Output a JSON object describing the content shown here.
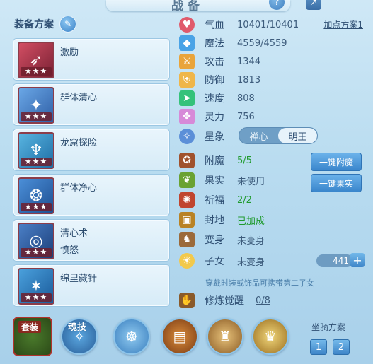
{
  "window": {
    "title": "战备"
  },
  "plan": {
    "title": "装备方案",
    "add_plan_label": "加点方案1"
  },
  "skills": [
    {
      "name": "激励",
      "sub": "",
      "stars": "★★★",
      "icon": "arrow-skill-icon",
      "color": "#b23a4d"
    },
    {
      "name": "群体清心",
      "sub": "",
      "stars": "★★★",
      "icon": "heal-skill-icon",
      "color": "#3f77c4"
    },
    {
      "name": "龙窟探险",
      "sub": "",
      "stars": "★★★",
      "icon": "dragon-skill-icon",
      "color": "#2e8fbd"
    },
    {
      "name": "群体净心",
      "sub": "",
      "stars": "★★★",
      "icon": "purify-skill-icon",
      "color": "#2b6fb0"
    },
    {
      "name": "清心术",
      "sub": "愤怒",
      "stars": "★★★",
      "icon": "gold-ring-skill-icon",
      "color": "#2d64a8"
    },
    {
      "name": "绵里藏针",
      "sub": "",
      "stars": "★★★",
      "icon": "needle-skill-icon",
      "color": "#2a7cc0"
    }
  ],
  "stats": {
    "hp": {
      "label": "气血",
      "value": "10401/10401"
    },
    "mp": {
      "label": "魔法",
      "value": "4559/4559"
    },
    "atk": {
      "label": "攻击",
      "value": "1344"
    },
    "def": {
      "label": "防御",
      "value": "1813"
    },
    "spd": {
      "label": "速度",
      "value": "808"
    },
    "spi": {
      "label": "灵力",
      "value": "756"
    },
    "star": {
      "label": "星象",
      "option1": "禅心",
      "option2": "明王"
    },
    "enchant": {
      "label": "附魔",
      "value": "5/5",
      "button": "一键附魔"
    },
    "fruit": {
      "label": "果实",
      "value": "未使用",
      "button": "一键果实"
    },
    "bless": {
      "label": "祈福",
      "value": "2/2"
    },
    "seal": {
      "label": "封地",
      "value": "已加成"
    },
    "transform": {
      "label": "变身",
      "value": "未变身"
    },
    "child": {
      "label": "子女",
      "value": "未变身",
      "level": "441"
    },
    "hint": "穿戴时装或饰品可携带第二子女",
    "cultivate": {
      "label": "修炼觉醒",
      "value": "0/8"
    }
  },
  "bottom": {
    "suit_label": "套装",
    "soul_label": "魂技",
    "mount_title": "坐骑方案",
    "mount_options": [
      "1",
      "2"
    ]
  }
}
